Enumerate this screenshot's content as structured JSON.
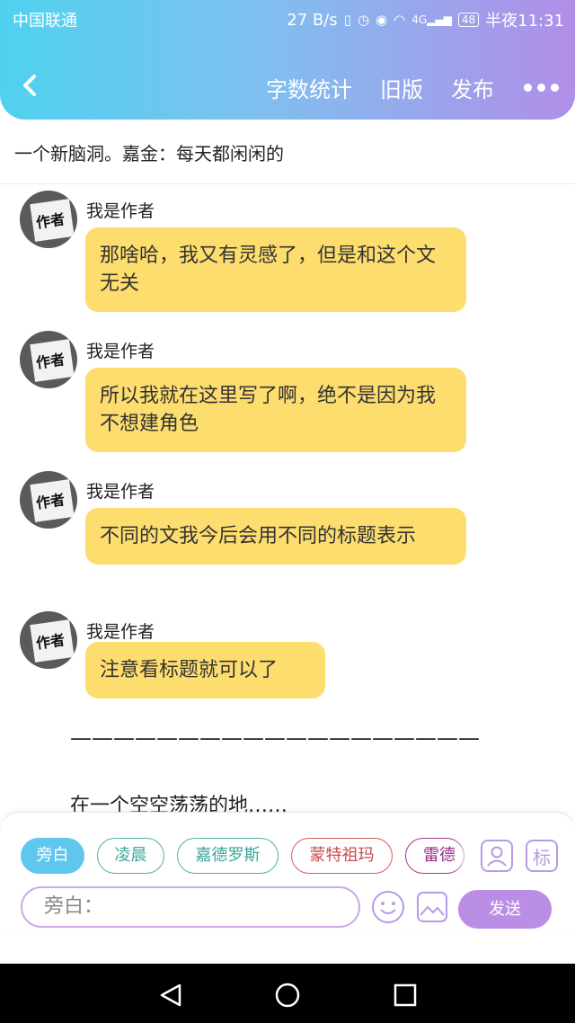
{
  "status_bar": {
    "carrier": "中国联通",
    "speed": "27 B/s",
    "network_type": "4G",
    "battery": "48",
    "time": "半夜11:31"
  },
  "header": {
    "back_icon": "chevron-left-icon",
    "actions": [
      "字数统计",
      "旧版",
      "发布"
    ],
    "more_icon": "more-dots-icon",
    "gradient": [
      "#4fd2ef",
      "#b08ee8"
    ]
  },
  "title": "一个新脑洞。嘉金：每天都闲闲的",
  "messages": [
    {
      "author": "我是作者",
      "avatar_text": "作者",
      "text": "那啥哈，我又有灵感了，但是和这个文无关"
    },
    {
      "author": "我是作者",
      "avatar_text": "作者",
      "text": "所以我就在这里写了啊，绝不是因为我不想建角色"
    },
    {
      "author": "我是作者",
      "avatar_text": "作者",
      "text": "不同的文我今后会用不同的标题表示"
    },
    {
      "author": "我是作者",
      "avatar_text": "作者",
      "text": "注意看标题就可以了"
    }
  ],
  "separator": "———————————————————",
  "narration": "在一个空空荡荡的地……",
  "composer": {
    "chips": [
      {
        "label": "旁白",
        "active": true
      },
      {
        "label": "凌晨",
        "color": "#49b2a6"
      },
      {
        "label": "嘉德罗斯",
        "color": "#49b2a6"
      },
      {
        "label": "蒙特祖玛",
        "color": "#d35b5b"
      },
      {
        "label": "雷德",
        "color": "#a0338f"
      }
    ],
    "role_icon": "person-icon",
    "tag_button": "标",
    "input_placeholder": "旁白：",
    "emoji_icon": "smiley-icon",
    "image_icon": "image-icon",
    "send_label": "发送"
  },
  "system_nav": [
    "back-triangle-icon",
    "home-circle-icon",
    "recents-square-icon"
  ]
}
